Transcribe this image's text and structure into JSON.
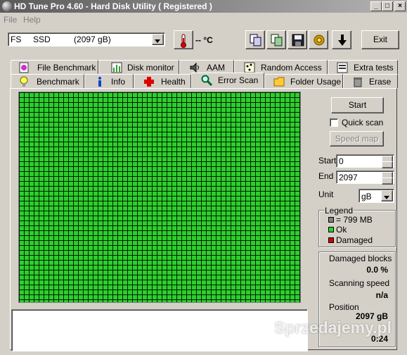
{
  "window": {
    "title": "HD Tune Pro 4.60 - Hard Disk Utility  ( Registered )"
  },
  "menu": {
    "file": "File",
    "help": "Help"
  },
  "toolbar": {
    "drive_label": "FS     SSD          (2097 gB)",
    "temperature": "-- °C",
    "exit_label": "Exit"
  },
  "tabs_top": [
    "File Benchmark",
    "Disk monitor",
    "AAM",
    "Random Access",
    "Extra tests"
  ],
  "tabs_bottom": [
    "Benchmark",
    "Info",
    "Health",
    "Error Scan",
    "Folder Usage",
    "Erase"
  ],
  "active_tab": "Error Scan",
  "controls": {
    "start_button": "Start",
    "quick_scan_label": "Quick scan",
    "quick_scan_checked": false,
    "speed_map_button": "Speed map",
    "start_label": "Start",
    "start_value": "0",
    "end_label": "End",
    "end_value": "2097",
    "unit_label": "Unit",
    "unit_value": "gB"
  },
  "legend": {
    "title": "Legend",
    "block_size": "= 799 MB",
    "ok": "Ok",
    "damaged": "Damaged",
    "colors": {
      "block": "#808080",
      "ok": "#2ccf2c",
      "damaged": "#cc0000"
    }
  },
  "stats": {
    "damaged_blocks_label": "Damaged blocks",
    "damaged_blocks_value": "0.0 %",
    "scanning_speed_label": "Scanning speed",
    "scanning_speed_value": "n/a",
    "position_label": "Position",
    "position_value": "2097 gB",
    "elapsed_value": "0:24"
  },
  "watermark": "Sprzedajemy.pl"
}
